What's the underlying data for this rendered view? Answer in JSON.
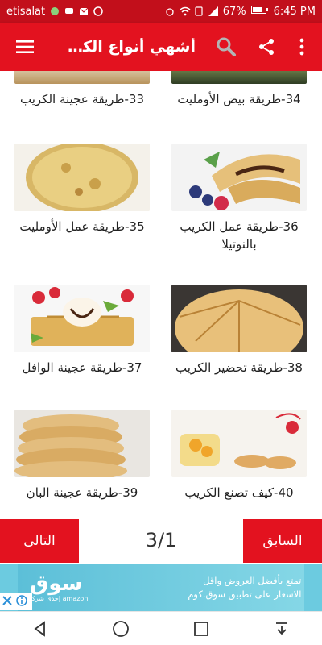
{
  "status_bar": {
    "carrier": "etisalat",
    "battery": "67%",
    "time": "6:45 PM"
  },
  "app_bar": {
    "title": "أشهي أنواع الكري...",
    "icons": [
      "menu-icon",
      "search-icon",
      "share-icon",
      "more-vert-icon"
    ]
  },
  "grid": {
    "items": [
      {
        "caption": "33-طريقة عجينة الكريب",
        "image": "crepe-batter-top"
      },
      {
        "caption": "34-طريقة بيض الأومليت",
        "image": "omelette-top"
      },
      {
        "caption": "35-طريقة عمل الأومليت",
        "image": "omelette-pan"
      },
      {
        "caption": "36-طريقة عمل الكريب بالنوتيلا",
        "image": "nutella-crepes"
      },
      {
        "caption": "37-طريقة عجينة الوافل",
        "image": "waffles-strawberry"
      },
      {
        "caption": "38-طريقة تحضير الكريب",
        "image": "crepe-pan-folded"
      },
      {
        "caption": "39-طريقة عجينة البان",
        "image": "pancake-stack"
      },
      {
        "caption": "40-كيف تصنع الكريب",
        "image": "mini-pancakes"
      }
    ]
  },
  "pager": {
    "next_label": "التالى",
    "prev_label": "السابق",
    "page_indicator": "3/1"
  },
  "ad": {
    "text": "تمتع بأفضل العروض واقل الاسعار على تطبيق سوق.كوم",
    "logo": "سوق",
    "logo_sub": "إحدى شركات amazon"
  },
  "colors": {
    "primary": "#e3121f",
    "status_bar": "#c20f1b",
    "ad_background": "#6ccbe0"
  }
}
